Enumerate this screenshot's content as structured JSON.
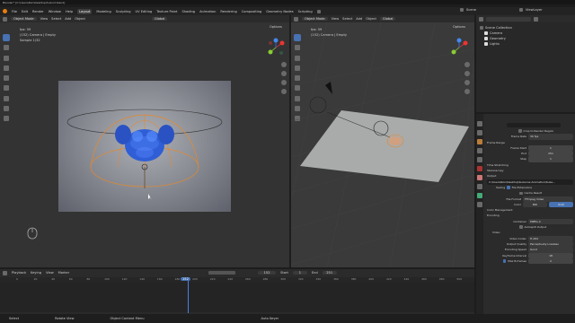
{
  "window": {
    "title": "Blender* [C:\\Users\\Ron\\Desktop\\Suzvid.blend]"
  },
  "menu": [
    "File",
    "Edit",
    "Render",
    "Window",
    "Help"
  ],
  "workspaces": [
    "Layout",
    "Modeling",
    "Sculpting",
    "UV Editing",
    "Texture Paint",
    "Shading",
    "Animation",
    "Rendering",
    "Compositing",
    "Geometry Nodes",
    "Scripting"
  ],
  "scene": {
    "label": "Scene",
    "view_layer": "ViewLayer"
  },
  "left_view": {
    "mode": "Object Mode",
    "menus": [
      "View",
      "Select",
      "Add",
      "Object"
    ],
    "orientation": "Global",
    "info": [
      "fps: 59",
      "(152) Camera | Empty",
      "Sample 1/32"
    ],
    "options": "Options"
  },
  "right_view": {
    "mode": "Object Mode",
    "menus": [
      "View",
      "Select",
      "Add",
      "Object"
    ],
    "orientation": "Global",
    "info": [
      "fps: 59",
      "(152) Camera | Empty"
    ],
    "options": "Options"
  },
  "outliner": {
    "title": "Scene Collection",
    "items": [
      "Camera",
      "Geometry",
      "Lights"
    ]
  },
  "props": {
    "crop": "Crop to Render Region",
    "frame_rate_label": "Frame Rate",
    "frame_rate": "30 fps",
    "frame_range": "Frame Range",
    "frame_start_label": "Frame Start",
    "frame_start": "1",
    "end_label": "End",
    "end": "251",
    "step_label": "Step",
    "step": "1",
    "time_stretching": "Time Stretching",
    "stereoscopy": "Stereoscopy",
    "output": "Output",
    "path": "C:\\Users\\Ron\\Desktop\\Suzanne Animation\\Suza...",
    "saving_label": "Saving",
    "file_ext": "File Extensions",
    "cache": "Cache Result",
    "file_format_label": "File Format",
    "file_format": "FFmpeg Video",
    "color_label": "Color",
    "bw": "BW",
    "rgb": "RGB",
    "color_mgmt": "Color Management",
    "encoding": "Encoding",
    "container_label": "Container",
    "container": "MPEG-4",
    "autosplit": "Autosplit Output",
    "video": "Video",
    "codec_label": "Video Codec",
    "codec": "H.264",
    "quality_label": "Output Quality",
    "quality": "Perceptually Lossless",
    "speed_label": "Encoding Speed",
    "speed": "Good",
    "keyframe_label": "Keyframe Interval",
    "keyframe": "18",
    "bframes_label": "Max B-frames",
    "bframes": "2"
  },
  "timeline": {
    "menus": [
      "Playback",
      "Keying",
      "View",
      "Marker"
    ],
    "current": "152",
    "start_label": "Start",
    "start": "1",
    "end_label": "End",
    "end": "251",
    "ticks": [
      "0",
      "20",
      "40",
      "60",
      "80",
      "100",
      "120",
      "140",
      "160",
      "180",
      "200",
      "220",
      "240",
      "260",
      "280",
      "300",
      "320",
      "340",
      "360",
      "380",
      "400",
      "420",
      "440",
      "460",
      "480",
      "500"
    ],
    "current_tick": "152"
  },
  "status": {
    "select": "Select",
    "rotate": "Rotate View",
    "menu": "Object Context Menu",
    "popup": "Auto Keyer"
  }
}
